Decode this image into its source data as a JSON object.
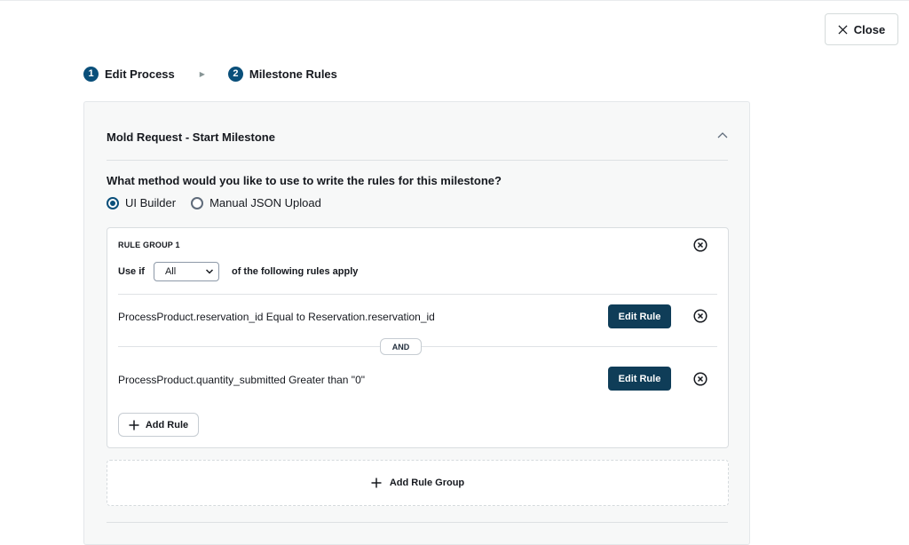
{
  "header": {
    "close_label": "Close"
  },
  "stepper": {
    "steps": [
      {
        "number": "1",
        "label": "Edit Process"
      },
      {
        "number": "2",
        "label": "Milestone Rules"
      }
    ]
  },
  "panel": {
    "title": "Mold Request - Start Milestone",
    "question": "What method would you like to use to write the rules for this milestone?",
    "method_options": [
      {
        "label": "UI Builder",
        "selected": true
      },
      {
        "label": "Manual JSON Upload",
        "selected": false
      }
    ],
    "rule_group": {
      "title": "RULE GROUP 1",
      "use_if_prefix": "Use if",
      "match_select": "All",
      "use_if_suffix": "of the following rules apply",
      "rules": [
        {
          "text": "ProcessProduct.reservation_id Equal to Reservation.reservation_id",
          "button": "Edit Rule"
        },
        {
          "text": "ProcessProduct.quantity_submitted Greater than \"0\"",
          "button": "Edit Rule"
        }
      ],
      "connector": "AND",
      "add_rule_label": "Add Rule"
    },
    "add_group_label": "Add Rule Group"
  },
  "colors": {
    "accent": "#0a4f7a",
    "button_dark": "#0f3d58"
  },
  "icons": [
    "close-icon",
    "caret-right-icon",
    "chevron-up-icon",
    "remove-circle-icon",
    "chevron-down-icon",
    "plus-icon"
  ]
}
